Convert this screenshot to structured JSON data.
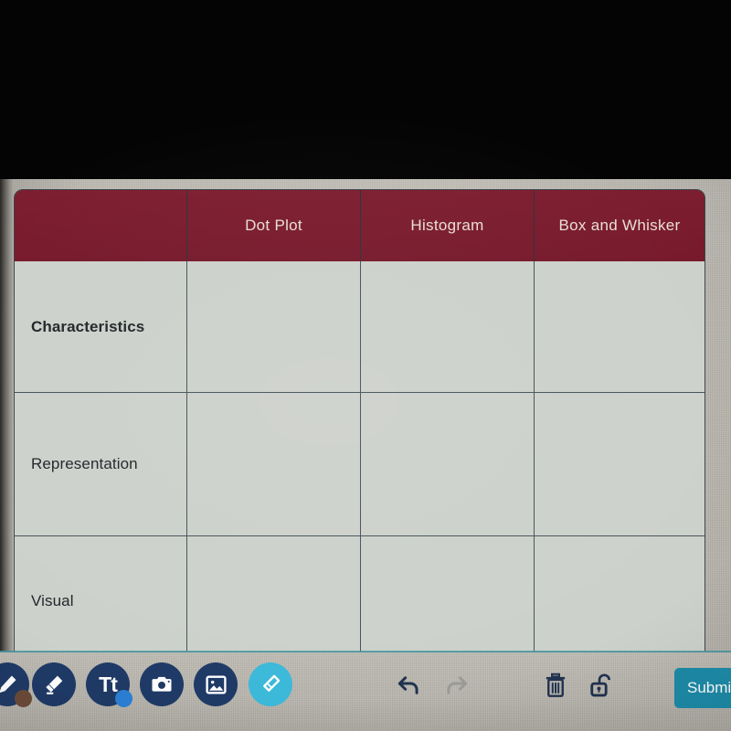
{
  "app": {
    "canvas_label": "worksheet-canvas"
  },
  "table": {
    "columns": [
      {
        "label": ""
      },
      {
        "label": "Dot Plot"
      },
      {
        "label": "Histogram"
      },
      {
        "label": "Box and Whisker"
      }
    ],
    "rows": [
      {
        "label": "Characteristics",
        "cells": [
          "",
          "",
          ""
        ]
      },
      {
        "label": "Representation",
        "cells": [
          "",
          "",
          ""
        ]
      },
      {
        "label": "Visual",
        "cells": [
          "",
          "",
          ""
        ]
      }
    ],
    "header_bg": "#7a1c2e",
    "header_text_color": "#e9ded2",
    "cell_bg": "#cdd1cb",
    "grid_color": "#46535c"
  },
  "toolbar": {
    "tools": [
      {
        "name": "pen-tool",
        "icon": "pen-icon",
        "color": "#1f3a66",
        "badge": "#6b4a38",
        "selected": false
      },
      {
        "name": "highlighter-tool",
        "icon": "highlighter-icon",
        "color": "#1f3a66",
        "badge": "",
        "selected": false
      },
      {
        "name": "text-tool",
        "icon": "text-icon",
        "color": "#1f3a66",
        "badge": "#2b7fd4",
        "selected": false,
        "glyph": "Tt"
      },
      {
        "name": "camera-tool",
        "icon": "camera-icon",
        "color": "#1f3a66",
        "badge": "",
        "selected": false
      },
      {
        "name": "image-tool",
        "icon": "image-icon",
        "color": "#1f3a66",
        "badge": "",
        "selected": false
      },
      {
        "name": "eraser-tool",
        "icon": "eraser-icon",
        "color": "#3cb9d9",
        "badge": "",
        "selected": true
      }
    ],
    "undo_label": "undo",
    "redo_label": "redo",
    "delete_label": "delete",
    "lock_label": "unlock",
    "submit_label": "Submit",
    "submit_color": "#1d8ba8"
  }
}
